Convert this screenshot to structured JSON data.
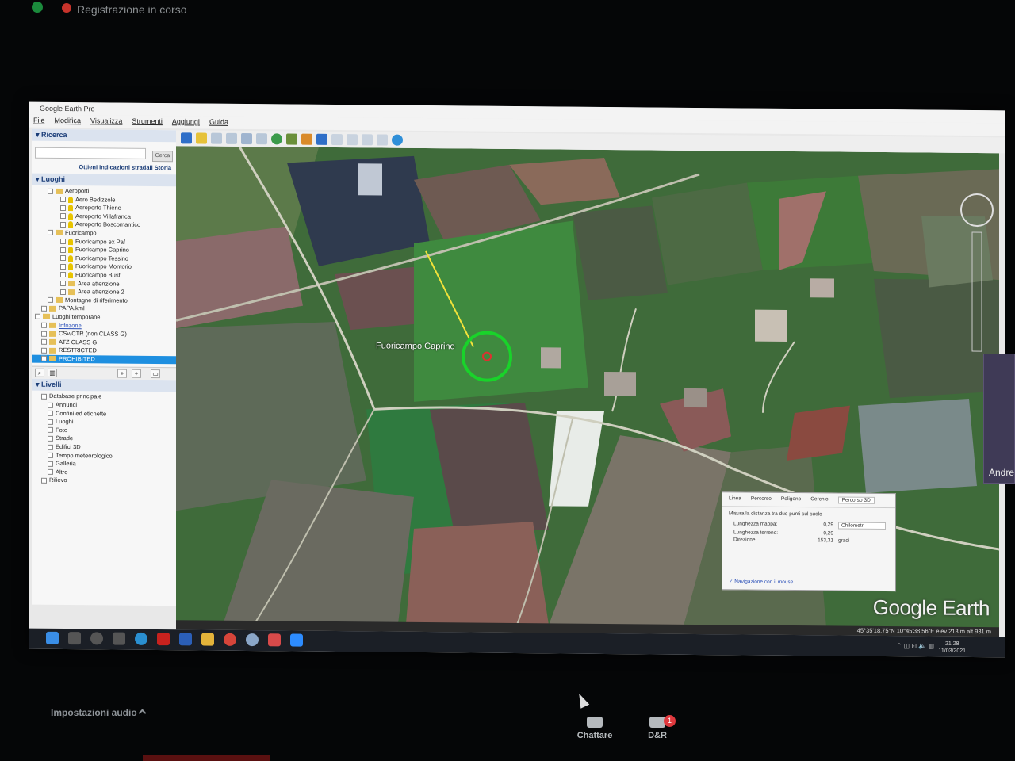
{
  "meeting": {
    "recording_label": "Registrazione in corso",
    "audio_settings_label": "Impostazioni audio",
    "chat_label": "Chattare",
    "qa_label": "D&R",
    "qa_badge": "1",
    "participant_name": "Andre"
  },
  "app": {
    "title": "Google Earth Pro",
    "menu": [
      "File",
      "Modifica",
      "Visualizza",
      "Strumenti",
      "Aggiungi",
      "Guida"
    ],
    "logo": "Google Earth"
  },
  "sidebar": {
    "search_header": "Ricerca",
    "search_button": "Cerca",
    "search_links": "Ottieni indicazioni stradali   Storia",
    "places_header": "Luoghi",
    "places": [
      {
        "label": "Aeroporti",
        "type": "folder",
        "indent": 2
      },
      {
        "label": "Aero Bedizzole",
        "type": "pin",
        "indent": 4
      },
      {
        "label": "Aeroporto Thiene",
        "type": "pin",
        "indent": 4
      },
      {
        "label": "Aeroporto Villafranca",
        "type": "pin",
        "indent": 4
      },
      {
        "label": "Aeroporto Boscomantico",
        "type": "pin",
        "indent": 4
      },
      {
        "label": "Fuoricampo",
        "type": "folder",
        "indent": 2
      },
      {
        "label": "Fuoricampo ex Paf",
        "type": "pin",
        "indent": 4
      },
      {
        "label": "Fuoricampo Caprino",
        "type": "pin",
        "indent": 4
      },
      {
        "label": "Fuoricampo Tessino",
        "type": "pin",
        "indent": 4
      },
      {
        "label": "Fuoricampo Montorio",
        "type": "pin",
        "indent": 4
      },
      {
        "label": "Fuoricampo Busti",
        "type": "pin",
        "indent": 4
      },
      {
        "label": "Area attenzione",
        "type": "item",
        "indent": 4
      },
      {
        "label": "Area attenzione 2",
        "type": "item",
        "indent": 4
      },
      {
        "label": "Montagne di riferimento",
        "type": "folder",
        "indent": 2
      },
      {
        "label": "PAPA.kml",
        "type": "item",
        "indent": 1
      },
      {
        "label": "Luoghi temporanei",
        "type": "folder",
        "indent": 0
      },
      {
        "label": "Infozone",
        "type": "link",
        "indent": 1
      },
      {
        "label": "CSv/CTR (non CLASS G)",
        "type": "folder",
        "indent": 1
      },
      {
        "label": "ATZ CLASS G",
        "type": "folder",
        "indent": 1
      },
      {
        "label": "RESTRICTED",
        "type": "folder",
        "indent": 1
      },
      {
        "label": "PROHIBITED",
        "type": "selected",
        "indent": 1
      }
    ],
    "layers_header": "Livelli",
    "layers": [
      {
        "label": "Database principale",
        "indent": 1
      },
      {
        "label": "Annunci",
        "indent": 2
      },
      {
        "label": "Confini ed etichette",
        "indent": 2
      },
      {
        "label": "Luoghi",
        "indent": 2
      },
      {
        "label": "Foto",
        "indent": 2
      },
      {
        "label": "Strade",
        "indent": 2
      },
      {
        "label": "Edifici 3D",
        "indent": 2
      },
      {
        "label": "Tempo meteorologico",
        "indent": 2
      },
      {
        "label": "Galleria",
        "indent": 2
      },
      {
        "label": "Altro",
        "indent": 2
      },
      {
        "label": "Rilievo",
        "indent": 1
      }
    ]
  },
  "map": {
    "placemark_label": "Fuoricampo Caprino"
  },
  "ruler": {
    "tabs": [
      "Linea",
      "Percorso",
      "Poligono",
      "Cerchio",
      "Percorso 3D"
    ],
    "active_tab": "Percorso 3D",
    "description": "Misura la distanza tra due punti sul suolo",
    "rows": [
      {
        "key": "Lunghezza mappa:",
        "value": "0,29"
      },
      {
        "key": "Lunghezza terreno:",
        "value": "0,29"
      },
      {
        "key": "Direzione:",
        "value": "153,31"
      }
    ],
    "unit": "Chilometri",
    "heading_unit": "gradi",
    "nav_label": "Navigazione con il mouse"
  },
  "status": {
    "coords": "45°35'18.75\"N   10°45'38.56\"E   elev  213 m   alt  931 m"
  },
  "clock": {
    "time": "21:28",
    "date": "11/03/2021"
  }
}
